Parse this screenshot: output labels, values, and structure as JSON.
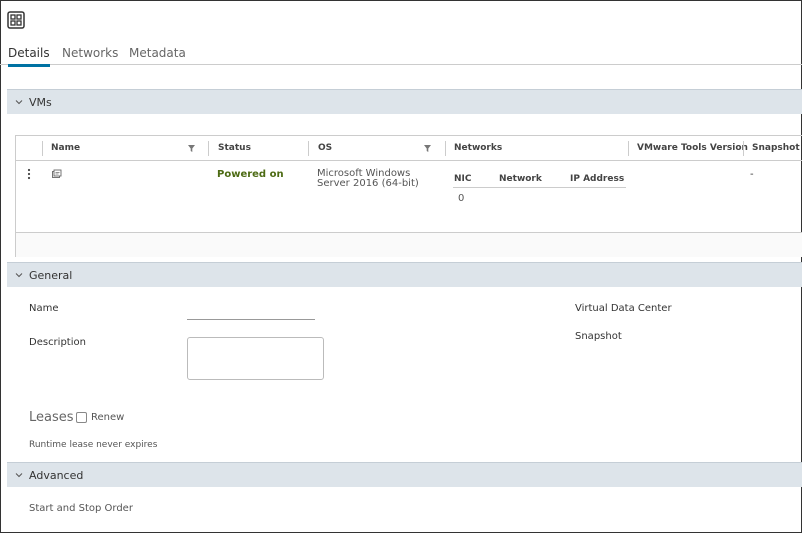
{
  "tabs": [
    {
      "label": "Details",
      "active": true
    },
    {
      "label": "Networks",
      "active": false
    },
    {
      "label": "Metadata",
      "active": false
    }
  ],
  "icons": {
    "app": "grid-expand-icon",
    "chevron": "chevron-down-icon",
    "filter": "filter-icon",
    "row_actions": "vertical-ellipsis-icon",
    "vm": "vm-console-icon"
  },
  "colors": {
    "accent": "#0072a3",
    "section_bg": "#dde4ea",
    "powered_on": "#4d6b14"
  },
  "vms_section": {
    "title": "VMs",
    "columns": [
      "Name",
      "Status",
      "OS",
      "Networks",
      "VMware Tools Version",
      "Snapshot"
    ],
    "rows": [
      {
        "name": "",
        "status": "Powered on",
        "os": "Microsoft Windows Server 2016 (64-bit)",
        "networks": {
          "headers": [
            "NIC",
            "Network",
            "IP Address"
          ],
          "rows": [
            {
              "nic": "0",
              "network": "",
              "ip": ""
            }
          ]
        },
        "tools_version": "",
        "snapshot": "-"
      }
    ]
  },
  "general_section": {
    "title": "General",
    "name_label": "Name",
    "name_value": "",
    "description_label": "Description",
    "description_value": "",
    "vdc_label": "Virtual Data Center",
    "snapshot_label": "Snapshot",
    "leases_label": "Leases",
    "renew_label": "Renew",
    "renew_checked": false,
    "lease_status": "Runtime lease never expires"
  },
  "advanced_section": {
    "title": "Advanced",
    "start_stop_label": "Start and Stop Order"
  }
}
